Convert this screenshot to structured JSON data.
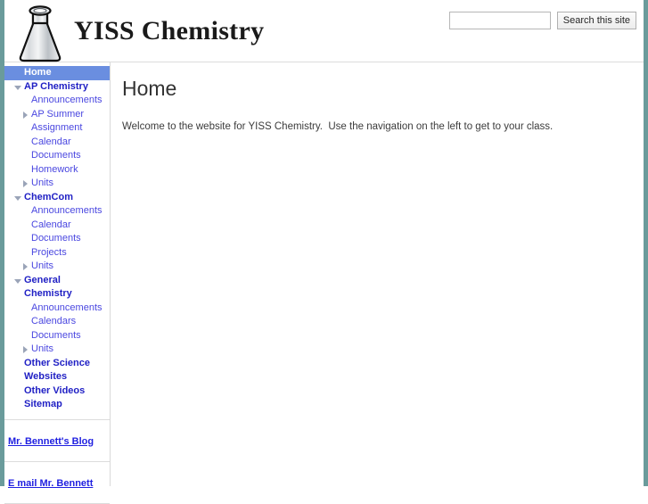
{
  "site": {
    "title": "YISS Chemistry",
    "logo_icon": "erlenmeyer-flask-icon"
  },
  "search": {
    "value": "",
    "placeholder": "",
    "button_label": "Search this site",
    "icon": "search-icon"
  },
  "sidebar": {
    "nav": [
      {
        "label": "Home",
        "level": 0,
        "selected": true,
        "arrow": "none"
      },
      {
        "label": "AP Chemistry",
        "level": 0,
        "selected": false,
        "arrow": "down"
      },
      {
        "label": "Announcements",
        "level": 1,
        "selected": false,
        "arrow": "none"
      },
      {
        "label": "AP Summer Assignment",
        "level": 1,
        "selected": false,
        "arrow": "right"
      },
      {
        "label": "Calendar",
        "level": 1,
        "selected": false,
        "arrow": "none"
      },
      {
        "label": "Documents",
        "level": 1,
        "selected": false,
        "arrow": "none"
      },
      {
        "label": "Homework",
        "level": 1,
        "selected": false,
        "arrow": "none"
      },
      {
        "label": "Units",
        "level": 1,
        "selected": false,
        "arrow": "right"
      },
      {
        "label": "ChemCom",
        "level": 0,
        "selected": false,
        "arrow": "down"
      },
      {
        "label": "Announcements",
        "level": 1,
        "selected": false,
        "arrow": "none"
      },
      {
        "label": "Calendar",
        "level": 1,
        "selected": false,
        "arrow": "none"
      },
      {
        "label": "Documents",
        "level": 1,
        "selected": false,
        "arrow": "none"
      },
      {
        "label": "Projects",
        "level": 1,
        "selected": false,
        "arrow": "none"
      },
      {
        "label": "Units",
        "level": 1,
        "selected": false,
        "arrow": "right"
      },
      {
        "label": "General Chemistry",
        "level": 0,
        "selected": false,
        "arrow": "down"
      },
      {
        "label": "Announcements",
        "level": 1,
        "selected": false,
        "arrow": "none"
      },
      {
        "label": "Calendars",
        "level": 1,
        "selected": false,
        "arrow": "none"
      },
      {
        "label": "Documents",
        "level": 1,
        "selected": false,
        "arrow": "none"
      },
      {
        "label": "Units",
        "level": 1,
        "selected": false,
        "arrow": "right"
      },
      {
        "label": "Other Science Websites",
        "level": 0,
        "selected": false,
        "arrow": "none"
      },
      {
        "label": "Other Videos",
        "level": 0,
        "selected": false,
        "arrow": "none"
      },
      {
        "label": "Sitemap",
        "level": 0,
        "selected": false,
        "arrow": "none"
      }
    ],
    "links": [
      {
        "label": "Mr. Bennett's Blog"
      },
      {
        "label": "E mail Mr. Bennett"
      }
    ]
  },
  "main": {
    "title": "Home",
    "paragraph": "Welcome to the website for YISS Chemistry.  Use the navigation on the left to get to your class."
  },
  "colors": {
    "edge_strip": "#6a9b9b",
    "selected_nav_bg": "#6a8ee0",
    "nav_link": "#4a47e0",
    "nav_header": "#1f1fc4",
    "body_text": "#3b3b3b"
  }
}
